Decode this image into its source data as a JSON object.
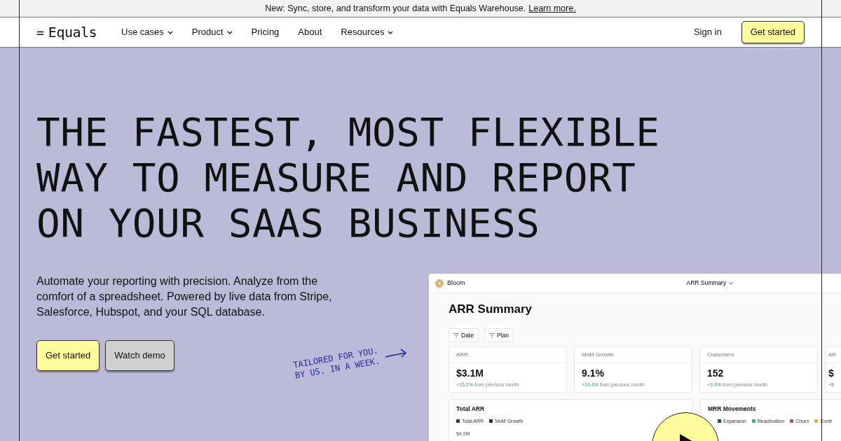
{
  "banner": {
    "text": "New: Sync, store, and transform your data with Equals Warehouse.",
    "link": "Learn more."
  },
  "nav": {
    "logo_mark": "=",
    "logo": "Equals",
    "items": [
      {
        "label": "Use cases",
        "dropdown": true
      },
      {
        "label": "Product",
        "dropdown": true
      },
      {
        "label": "Pricing",
        "dropdown": false
      },
      {
        "label": "About",
        "dropdown": false
      },
      {
        "label": "Resources",
        "dropdown": true
      }
    ],
    "sign_in": "Sign in",
    "cta": "Get started"
  },
  "hero": {
    "headline_lines": [
      "THE FASTEST, MOST FLEXIBLE",
      "WAY TO MEASURE AND REPORT",
      "ON YOUR SAAS BUSINESS"
    ],
    "description": "Automate your reporting with precision. Analyze from the comfort of a spreadsheet. Powered by live data from Stripe, Salesforce, Hubspot, and your SQL database.",
    "buttons": [
      {
        "label": "Get started",
        "kind": "primary"
      },
      {
        "label": "Watch demo",
        "kind": "secondary"
      }
    ],
    "annotation_lines": [
      "TAILORED FOR YOU.",
      "BY US. IN A WEEK."
    ]
  },
  "dashboard": {
    "brand": "Bloom",
    "report_menu": "ARR Summary",
    "title": "ARR Summary",
    "filters": [
      "Date",
      "Plan"
    ],
    "metrics": [
      {
        "label": "ARR",
        "value": "$3.1M",
        "change": "+15.2%",
        "note": "from previous month"
      },
      {
        "label": "MoM Growth",
        "value": "9.1%",
        "change": "+10.4%",
        "note": "from previous month"
      },
      {
        "label": "Customers",
        "value": "152",
        "change": "+3.4%",
        "note": "from previous month"
      },
      {
        "label": "AR",
        "value": "$",
        "change": "+8"
      }
    ],
    "panels": [
      {
        "title": "Total ARR",
        "legend": [
          {
            "label": "Total ARR",
            "color": "#1f3f5f"
          },
          {
            "label": "MoM Growth",
            "color": "#333333"
          }
        ],
        "axis_label": "$4.0M"
      },
      {
        "title": "MRR Movements",
        "legend": [
          {
            "label": "Expansion",
            "color": "#1f4f5f"
          },
          {
            "label": "Reactivation",
            "color": "#33aaaa"
          },
          {
            "label": "Churn",
            "color": "#c05070"
          },
          {
            "label": "Contr",
            "color": "#e0b040"
          }
        ]
      }
    ]
  }
}
